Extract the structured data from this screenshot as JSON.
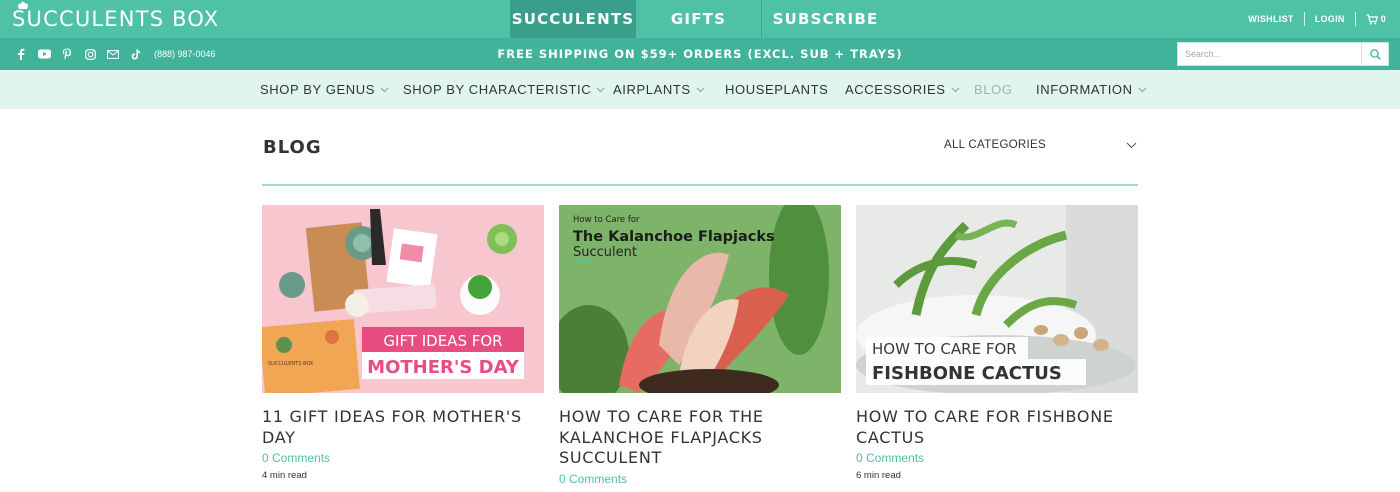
{
  "brand": {
    "name": "SUCCULENTS BOX"
  },
  "top_nav": [
    "SUCCULENTS",
    "GIFTS",
    "SUBSCRIBE"
  ],
  "top_links": {
    "wishlist": "WISHLIST",
    "login": "LOGIN",
    "cart_count": "0"
  },
  "announcement": {
    "phone": "(888) 987-0046",
    "text": "FREE SHIPPING ON $59+ ORDERS (EXCL. SUB + TRAYS)",
    "social_icons": [
      "facebook-icon",
      "youtube-icon",
      "pinterest-icon",
      "instagram-icon",
      "mail-icon",
      "tiktok-icon"
    ]
  },
  "search": {
    "placeholder": "Search..."
  },
  "main_nav": [
    {
      "label": "SHOP BY GENUS"
    },
    {
      "label": "SHOP BY CHARACTERISTIC"
    },
    {
      "label": "AIRPLANTS"
    },
    {
      "label": "HOUSEPLANTS"
    },
    {
      "label": "ACCESSORIES"
    },
    {
      "label": "BLOG"
    },
    {
      "label": "INFORMATION"
    }
  ],
  "blog": {
    "title": "BLOG",
    "category_filter": "ALL CATEGORIES",
    "posts": [
      {
        "title": "11 GIFT IDEAS FOR MOTHER'S DAY",
        "comments": "0 Comments",
        "read_time": "4 min read",
        "image_text": {
          "line1": "GIFT IDEAS FOR",
          "line2": "MOTHER'S DAY",
          "box_brand": "SUCCULENTS BOX"
        }
      },
      {
        "title": "HOW TO CARE FOR THE KALANCHOE FLAPJACKS SUCCULENT",
        "comments": "0 Comments",
        "read_time": "",
        "image_text": {
          "line1": "How to Care for",
          "line2": "The Kalanchoe Flapjacks",
          "line3": "Succulent"
        }
      },
      {
        "title": "HOW TO CARE FOR FISHBONE CACTUS",
        "comments": "0 Comments",
        "read_time": "6 min read",
        "image_text": {
          "line1": "HOW TO CARE FOR",
          "line2": "FISHBONE CACTUS"
        }
      }
    ]
  },
  "colors": {
    "primary": "#4fc1a7",
    "secondary": "#40b39a",
    "nav_bg": "#e0f5f0",
    "accent_text": "#52c0a8",
    "pink": "#e84d7f"
  }
}
